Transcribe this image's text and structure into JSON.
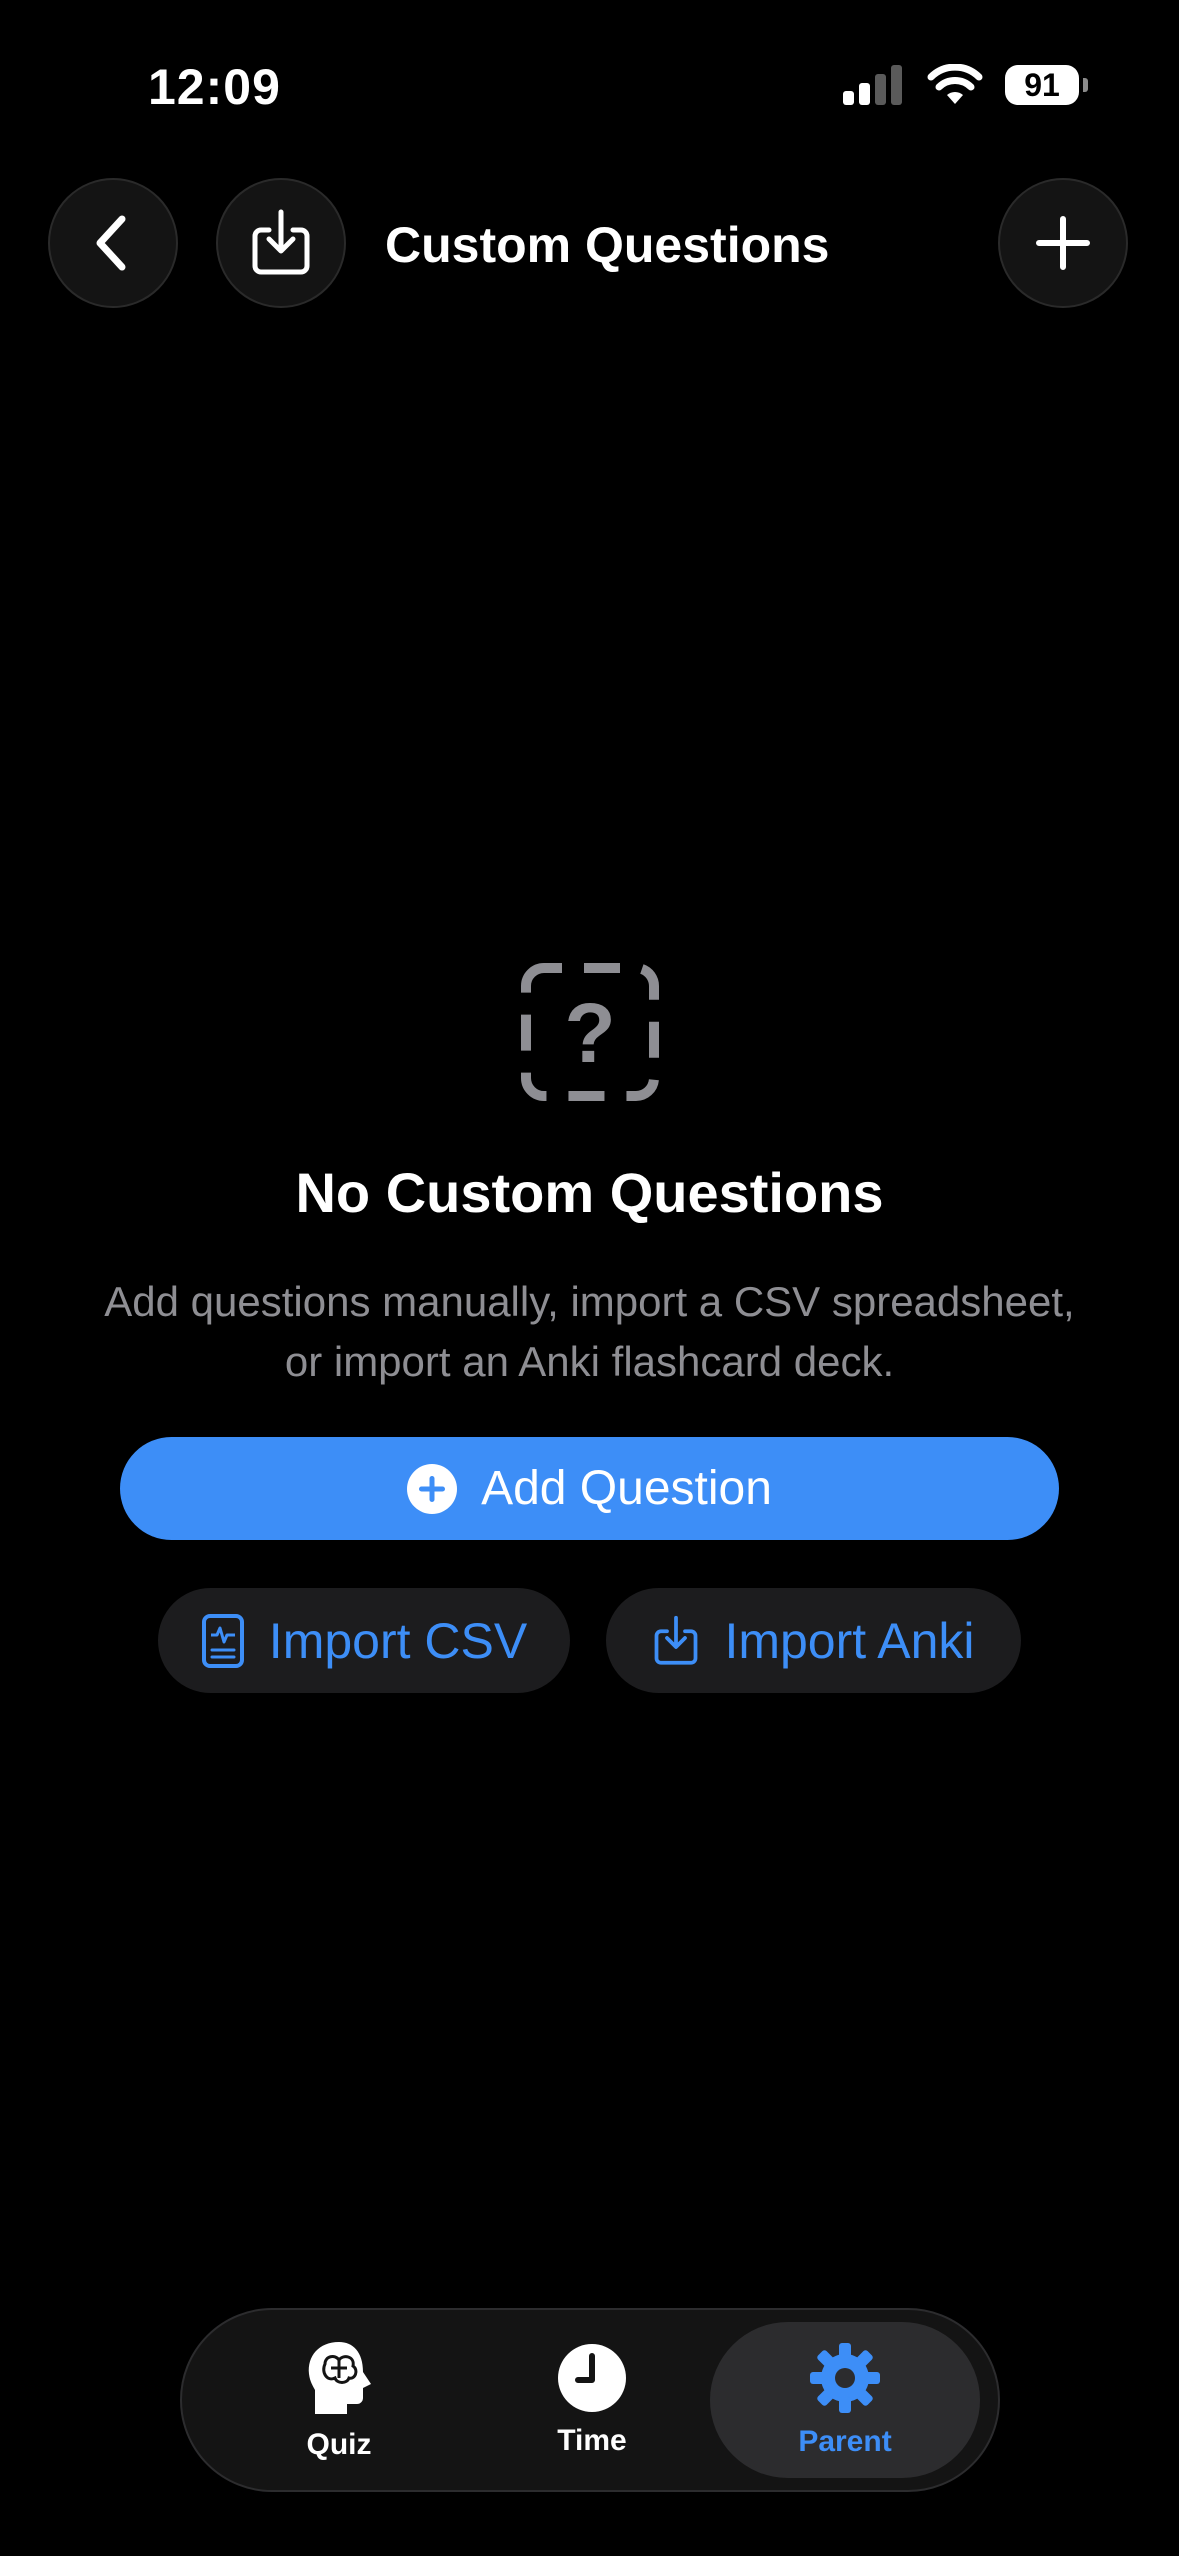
{
  "status_bar": {
    "time": "12:09",
    "battery": "91"
  },
  "header": {
    "title": "Custom Questions"
  },
  "empty_state": {
    "title": "No Custom Questions",
    "description": "Add questions manually, import a CSV spreadsheet, or import an Anki flashcard deck.",
    "add_question_label": "Add Question",
    "import_csv_label": "Import CSV",
    "import_anki_label": "Import Anki"
  },
  "tabs": [
    {
      "label": "Quiz",
      "icon": "brain-head-icon",
      "active": false
    },
    {
      "label": "Time",
      "icon": "clock-icon",
      "active": false
    },
    {
      "label": "Parent",
      "icon": "gear-icon",
      "active": true
    }
  ],
  "colors": {
    "accent": "#3d8ef7",
    "background": "#000000",
    "muted_text": "#8e8e93"
  }
}
